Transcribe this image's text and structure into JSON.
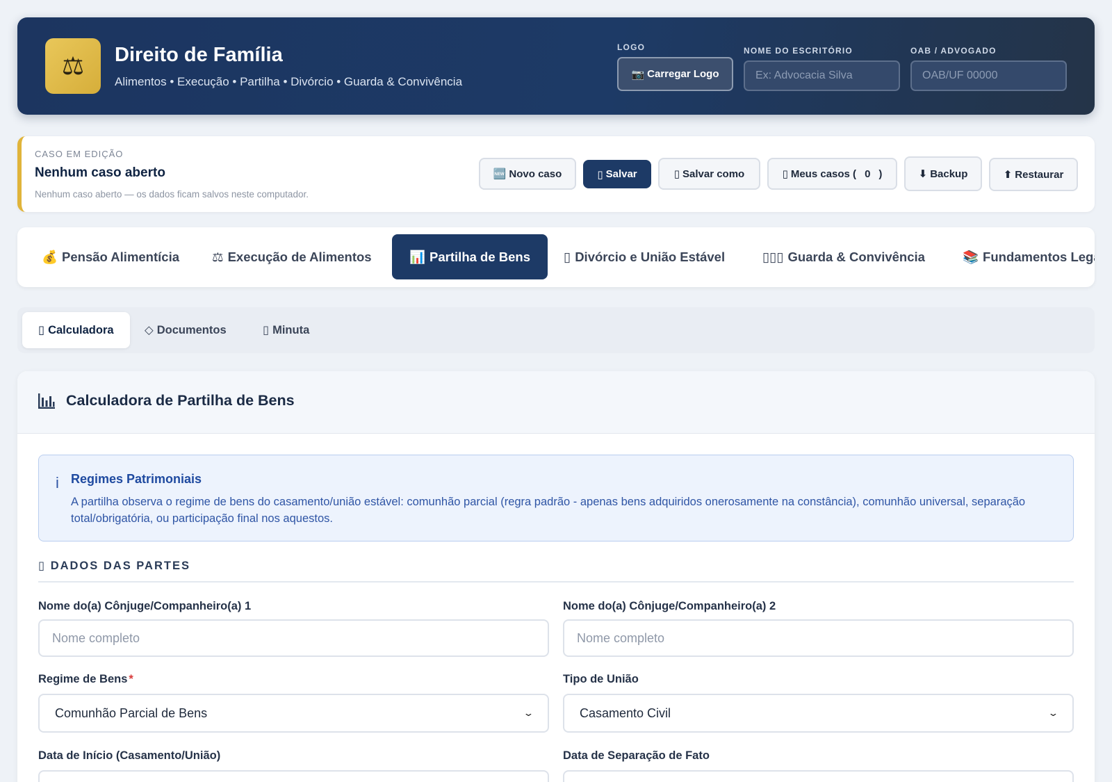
{
  "header": {
    "logo_glyph": "⚖",
    "title": "Direito de Família",
    "subtitle": "Alimentos • Execução • Partilha • Divórcio • Guarda & Convivência",
    "logo_label": "LOGO",
    "logo_button": "Carregar Logo",
    "office_label": "NOME DO ESCRITÓRIO",
    "office_placeholder": "Ex: Advocacia Silva",
    "oab_label": "OAB / ADVOGADO",
    "oab_placeholder": "OAB/UF 00000"
  },
  "case": {
    "label": "CASO EM EDIÇÃO",
    "title": "Nenhum caso aberto",
    "note": "Nenhum caso aberto — os dados ficam salvos neste computador.",
    "buttons": {
      "new": "Novo caso",
      "save": "Salvar",
      "save_as": "Salvar como",
      "my_cases": "Meus casos (",
      "my_cases_count": "0",
      "my_cases_close": ")",
      "backup": "Backup",
      "restore": "Restaurar"
    }
  },
  "modules": [
    {
      "label": "Pensão Alimentícia",
      "icon": "💰"
    },
    {
      "label": "Execução de Alimentos",
      "icon": "⚖"
    },
    {
      "label": "Partilha de Bens",
      "icon": "📊"
    },
    {
      "label": "Divórcio e União Estável",
      "icon": "▯"
    },
    {
      "label": "Guarda & Convivência",
      "icon": "▯▯▯"
    },
    {
      "label": "Fundamentos Legais",
      "icon": "📚"
    }
  ],
  "active_module": "Partilha de Bens",
  "subtabs": [
    {
      "label": "Calculadora",
      "icon": "▯"
    },
    {
      "label": "Documentos",
      "icon": "◇"
    },
    {
      "label": "Minuta",
      "icon": "▯"
    }
  ],
  "active_subtab": "Calculadora",
  "card": {
    "title": "Calculadora de Partilha de Bens",
    "info_icon": "i",
    "info_title": "Regimes Patrimoniais",
    "info_text": "A partilha observa o regime de bens do casamento/união estável: comunhão parcial (regra padrão - apenas bens adquiridos onerosamente na constância), comunhão universal, separação total/obrigatória, ou participação final nos aquestos.",
    "section_title": "DADOS DAS PARTES",
    "fields": {
      "spouse1_label": "Nome do(a) Cônjuge/Companheiro(a) 1",
      "spouse1_placeholder": "Nome completo",
      "spouse2_label": "Nome do(a) Cônjuge/Companheiro(a) 2",
      "spouse2_placeholder": "Nome completo",
      "regime_label": "Regime de Bens",
      "regime_required": "*",
      "regime_value": "Comunhão Parcial de Bens",
      "union_label": "Tipo de União",
      "union_value": "Casamento Civil",
      "start_label": "Data de Início (Casamento/União)",
      "separation_label": "Data de Separação de Fato"
    }
  },
  "colors": {
    "header_bg": "#1d3a66",
    "accent_gold": "#e0b43a",
    "primary": "#1d3a66",
    "info_blue": "#1f4aa0",
    "required_red": "#d83a3a"
  }
}
